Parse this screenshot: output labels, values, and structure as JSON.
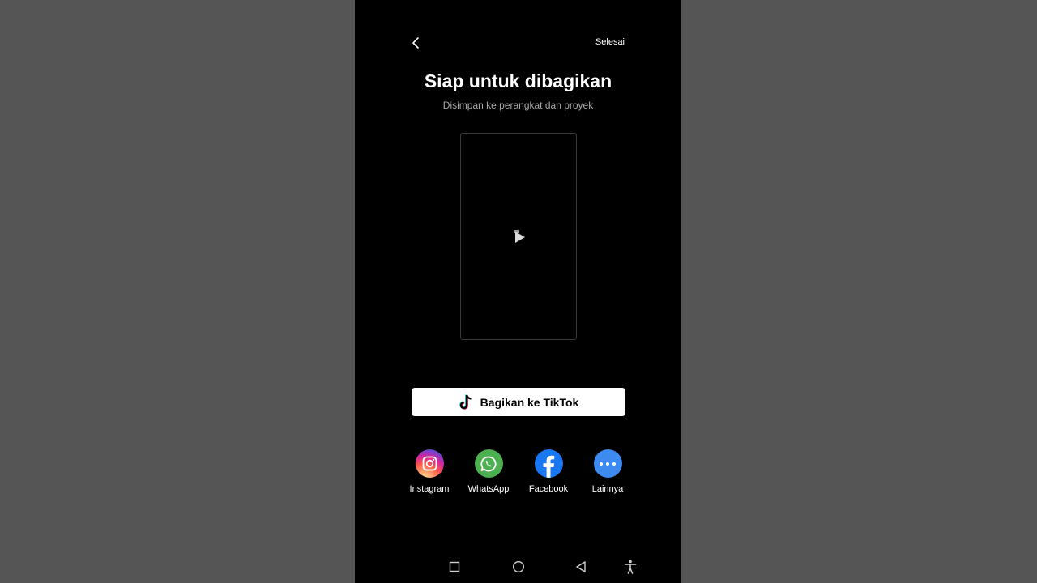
{
  "header": {
    "done_label": "Selesai"
  },
  "main": {
    "title": "Siap untuk dibagikan",
    "subtitle": "Disimpan ke perangkat dan proyek"
  },
  "share": {
    "tiktok_label": "Bagikan ke TikTok",
    "apps": [
      {
        "label": "Instagram",
        "icon": "instagram-icon"
      },
      {
        "label": "WhatsApp",
        "icon": "whatsapp-icon",
        "color": "#4CAF50"
      },
      {
        "label": "Facebook",
        "icon": "facebook-icon",
        "color": "#1877F2"
      },
      {
        "label": "Lainnya",
        "icon": "more-icon",
        "color": "#3D8AF0"
      }
    ]
  },
  "navbar": {
    "icons": [
      "recents-icon",
      "home-icon",
      "back-triangle-icon",
      "accessibility-icon"
    ]
  }
}
